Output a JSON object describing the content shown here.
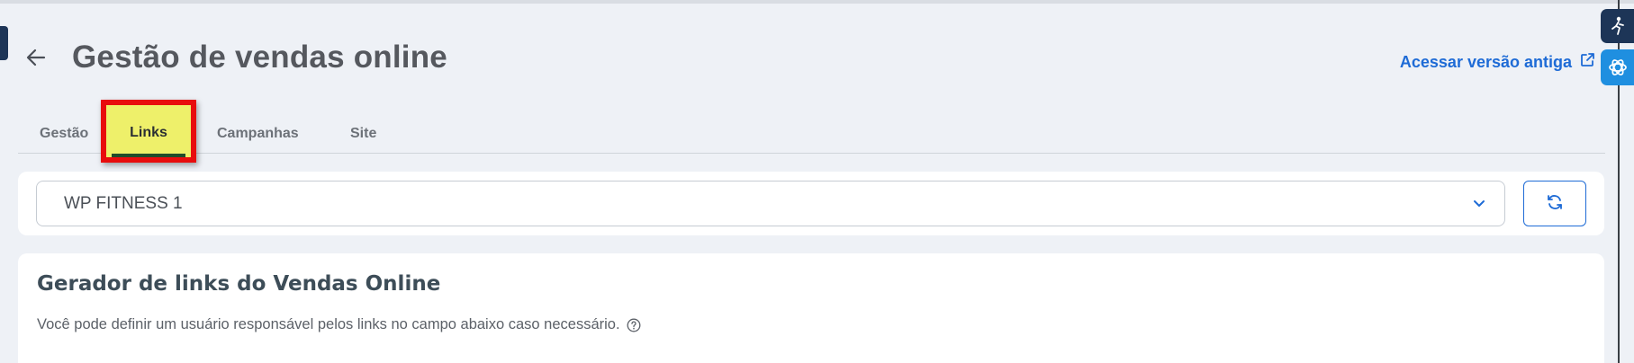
{
  "header": {
    "title": "Gestão de vendas online",
    "old_version_link": "Acessar versão antiga"
  },
  "tabs": [
    {
      "label": "Gestão",
      "active": false
    },
    {
      "label": "Links",
      "active": true
    },
    {
      "label": "Campanhas",
      "active": false
    },
    {
      "label": "Site",
      "active": false
    }
  ],
  "selector": {
    "value": "WP FITNESS 1"
  },
  "card": {
    "title": "Gerador de links do Vendas Online",
    "description": "Você pode definir um usuário responsável pelos links no campo abaixo caso necessário."
  },
  "colors": {
    "accent": "#1e6bd6",
    "highlight_border": "#e80d0d",
    "highlight_fill": "#eef06a",
    "background": "#eef1f6"
  },
  "icons": {
    "back": "arrow-left-icon",
    "external": "external-link-icon",
    "chevron": "chevron-down-icon",
    "refresh": "refresh-icon",
    "help": "question-circle-icon",
    "accessibility": "accessibility-icon",
    "assistant": "openai-icon"
  }
}
